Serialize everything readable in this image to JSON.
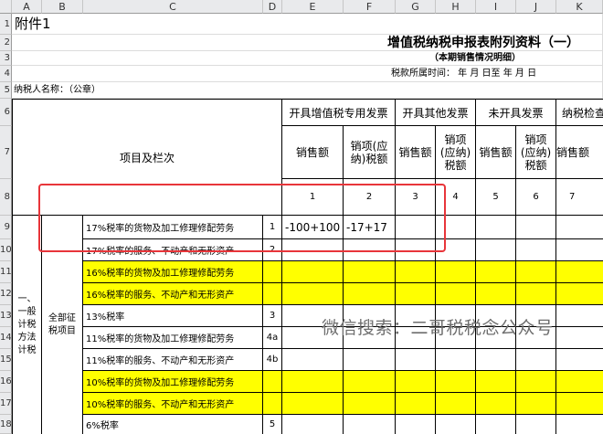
{
  "columns": [
    "A",
    "B",
    "C",
    "D",
    "E",
    "F",
    "G",
    "H",
    "I",
    "J",
    "K"
  ],
  "rows": [
    "1",
    "2",
    "3",
    "4",
    "5",
    "6",
    "7",
    "8",
    "9",
    "10",
    "11",
    "12",
    "13",
    "14",
    "15",
    "16",
    "17",
    "18"
  ],
  "sheet": {
    "attachment": "附件1",
    "title": "增值税纳税申报表附列资料（一）",
    "subtitle": "（本期销售情况明细）",
    "period": "税款所属时间：  年   月  日至   年   月   日",
    "taxpayer": "纳税人名称：（公章）"
  },
  "table": {
    "item_header": "项目及栏次",
    "groups": [
      "开具增值税专用发票",
      "开具其他发票",
      "未开具发票",
      "纳税检查"
    ],
    "sub": {
      "sales": "销售额",
      "tax_e": "销项(应纳)税额",
      "tax_h": "销项(应纳)税额",
      "tax_j": "销项(应纳)税额"
    },
    "col_numbers": [
      "1",
      "2",
      "3",
      "4",
      "5",
      "6",
      "7"
    ],
    "side_label": "一、一般计税方法计税",
    "group_label": "全部征税项目",
    "rows": [
      {
        "label": "17%税率的货物及加工修理修配劳务",
        "no": "1",
        "e": "-100+100",
        "f": "-17+17",
        "yellow": false
      },
      {
        "label": "17%税率的服务、不动产和无形资产",
        "no": "2",
        "e": "",
        "f": "",
        "yellow": false
      },
      {
        "label": "16%税率的货物及加工修理修配劳务",
        "no": "",
        "e": "",
        "f": "",
        "yellow": true
      },
      {
        "label": "16%税率的服务、不动产和无形资产",
        "no": "",
        "e": "",
        "f": "",
        "yellow": true
      },
      {
        "label": "13%税率",
        "no": "3",
        "e": "",
        "f": "",
        "yellow": false
      },
      {
        "label": "11%税率的货物及加工修理修配劳务",
        "no": "4a",
        "e": "",
        "f": "",
        "yellow": false
      },
      {
        "label": "11%税率的服务、不动产和无形资产",
        "no": "4b",
        "e": "",
        "f": "",
        "yellow": false
      },
      {
        "label": "10%税率的货物及加工修理修配劳务",
        "no": "",
        "e": "",
        "f": "",
        "yellow": true
      },
      {
        "label": "10%税率的服务、不动产和无形资产",
        "no": "",
        "e": "",
        "f": "",
        "yellow": true
      },
      {
        "label": "6%税率",
        "no": "5",
        "e": "",
        "f": "",
        "yellow": false
      }
    ]
  },
  "watermark": "微信搜索：二哥税税念公众号",
  "colors": {
    "highlight": "#ffff00",
    "annotation_box": "#e8353a"
  }
}
